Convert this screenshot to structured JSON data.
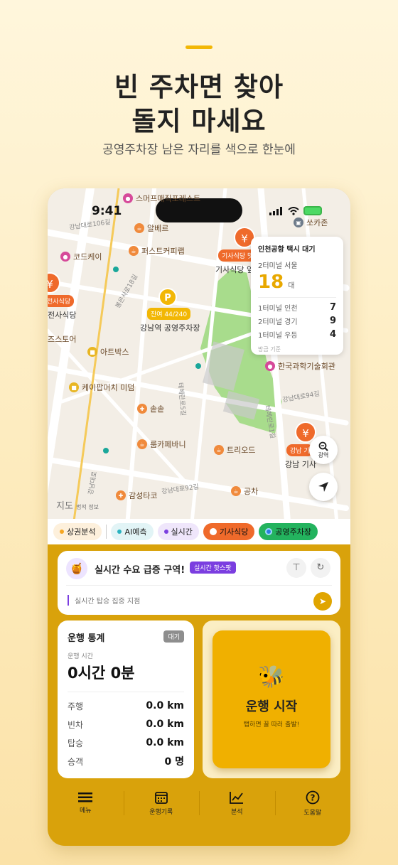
{
  "promo": {
    "headline_line1": "빈 주차면 찾아",
    "headline_line2": "돌지 마세요",
    "subheadline": "공영주차장 남은 자리를 색으로 한눈에"
  },
  "status_bar": {
    "time": "9:41"
  },
  "map": {
    "pois": [
      {
        "label": "스머프매직포레스트",
        "icon": "pin-icon"
      },
      {
        "label": "알베르",
        "icon": "cafe-icon"
      },
      {
        "label": "퍼스트커피랩",
        "icon": "cafe-icon"
      },
      {
        "label": "코드케이",
        "icon": "pin-icon"
      },
      {
        "label": "쏘카존",
        "icon": "car-icon"
      },
      {
        "label": "아트박스",
        "icon": "shop-icon"
      },
      {
        "label": "케이팝머치 미덤",
        "icon": "shop-icon"
      },
      {
        "label": "솥솥",
        "icon": "food-icon"
      },
      {
        "label": "룸카페바니",
        "icon": "cafe-icon"
      },
      {
        "label": "트리오드",
        "icon": "cafe-icon"
      },
      {
        "label": "한국과학기술회관",
        "icon": "pin-icon"
      },
      {
        "label": "감성타코",
        "icon": "food-icon"
      },
      {
        "label": "공차",
        "icon": "cafe-icon"
      },
      {
        "label": "즈스토어",
        "icon": "shop-icon"
      }
    ],
    "restaurant_markers": [
      {
        "tag": "기사식당 맛",
        "name": "기사식당 앞"
      },
      {
        "tag": "전사식당",
        "name": "전사식당"
      },
      {
        "tag": "강남 기",
        "name": "강남 기사"
      }
    ],
    "parking": {
      "symbol": "P",
      "tag": "잔여 44/240",
      "name": "강남역 공영주차장"
    },
    "road_labels": [
      "강남대로106길",
      "강남대로96길",
      "테헤란로5길",
      "강남대로94길",
      "테헤란로1길",
      "강남대로92길",
      "봉은사로18길",
      "테헤란로7길",
      "강남대로"
    ],
    "attribution": "지도",
    "attribution_sub": "법적 정보"
  },
  "airport_card": {
    "title": "인천공항 택시 대기",
    "sub": "2터미널 서울",
    "big_value": "18",
    "big_unit": "대",
    "rows": [
      {
        "label": "1터미널 인천",
        "value": "7"
      },
      {
        "label": "2터미널 경기",
        "value": "9"
      },
      {
        "label": "1터미널 우등",
        "value": "4"
      }
    ],
    "footer": "방금 기준"
  },
  "map_controls": {
    "zoom_label": "광역"
  },
  "chips": [
    {
      "label": "상권분석",
      "dot": "#f5a623",
      "bg": "#fdf0dc"
    },
    {
      "label": "AI예측",
      "dot": "#2bb3c0",
      "bg": "#e2f4f6"
    },
    {
      "label": "실시간",
      "dot": "#7b3ee0",
      "bg": "#efe6fb"
    },
    {
      "label": "기사식당",
      "dot": "#ffffff",
      "bg": "#ef6a2b"
    },
    {
      "label": "공영주차장",
      "dot": "#2a7de1",
      "bg": "#23b35e"
    }
  ],
  "alert": {
    "title": "실시간 수요 급증 구역!",
    "badge": "실시간 핫스팟",
    "hint": "실시간 탑승 집중 지점"
  },
  "stats": {
    "title": "운행 통계",
    "badge": "대기",
    "time_label": "운행 시간",
    "time_value": "0시간 0분",
    "rows": [
      {
        "label": "주행",
        "value": "0.0 km"
      },
      {
        "label": "빈차",
        "value": "0.0 km"
      },
      {
        "label": "탑승",
        "value": "0.0 km"
      },
      {
        "label": "승객",
        "value": "0 명"
      }
    ]
  },
  "start": {
    "title": "운행 시작",
    "subtitle": "탭하면 꿀 따러 출발!"
  },
  "tabs": [
    {
      "label": "메뉴",
      "icon": "menu-icon"
    },
    {
      "label": "운행기록",
      "icon": "calendar-icon"
    },
    {
      "label": "분석",
      "icon": "chart-icon"
    },
    {
      "label": "도움말",
      "icon": "help-icon"
    }
  ],
  "colors": {
    "accent": "#f2b705",
    "panel": "#d9a20b",
    "restaurant": "#ef6a2b",
    "hotspot": "#7b3ee0"
  }
}
